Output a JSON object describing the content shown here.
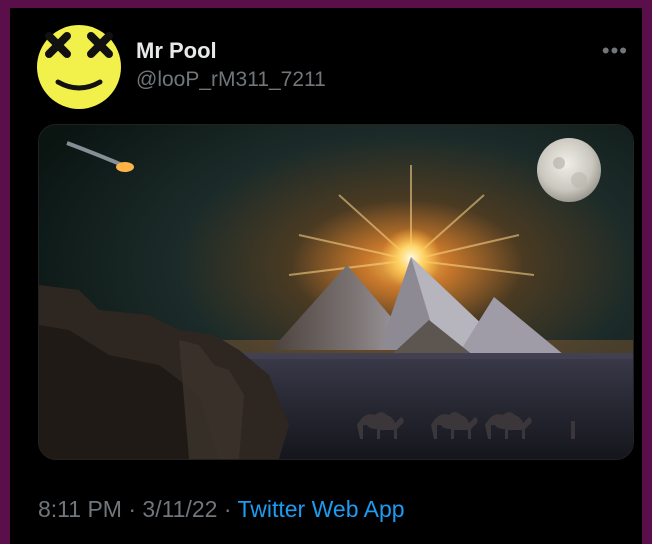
{
  "tweet": {
    "author_name": "Mr Pool",
    "author_handle": "@looP_rM311_7211",
    "time": "8:11 PM",
    "date": "3/11/22",
    "separator": "·",
    "source_app": "Twitter Web App"
  },
  "icons": {
    "more": "more-options-icon",
    "avatar": "smiley-x-eyes"
  },
  "colors": {
    "border": "#5a0f4a",
    "background": "#000000",
    "link": "#1d9bf0",
    "secondary_text": "#71767b",
    "avatar_yellow": "#f2f04a"
  }
}
